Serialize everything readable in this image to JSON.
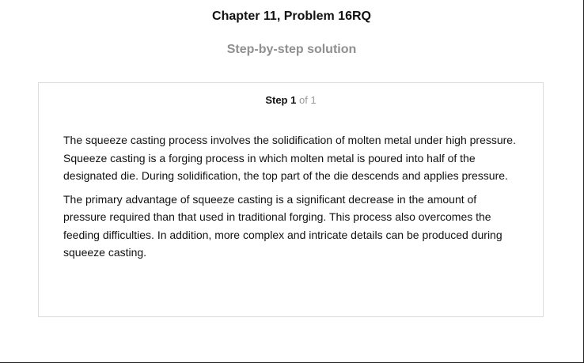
{
  "header": {
    "title": "Chapter 11, Problem 16RQ",
    "subtitle": "Step-by-step solution"
  },
  "step": {
    "label": "Step",
    "number": "1",
    "of_total": "of 1"
  },
  "solution": {
    "paragraphs": [
      "The squeeze casting process involves the solidification of molten metal under high pressure. Squeeze casting is a forging process in which molten metal is poured into half of the designated die. During solidification, the top part of the die descends and applies pressure.",
      "The primary advantage of squeeze casting is a significant decrease in the amount of pressure required than that used in traditional forging. This process also overcomes the feeding difficulties. In addition, more complex and intricate details can be produced during squeeze casting."
    ]
  },
  "colors": {
    "text": "#111111",
    "muted": "#8f8f8f",
    "card_border": "#dcdcdc"
  }
}
